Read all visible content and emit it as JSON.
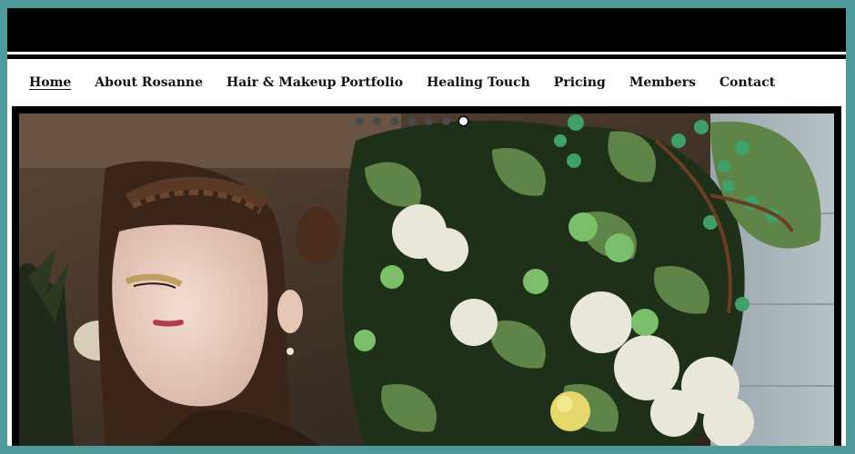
{
  "nav": {
    "items": [
      {
        "label": "Home",
        "active": true
      },
      {
        "label": "About Rosanne"
      },
      {
        "label": "Hair & Makeup Portfolio"
      },
      {
        "label": "Healing Touch"
      },
      {
        "label": "Pricing"
      },
      {
        "label": "Members"
      },
      {
        "label": "Contact"
      }
    ]
  },
  "slider": {
    "slide_count": 7,
    "active_index": 6,
    "colors": {
      "frame": "#4e9a9b",
      "header": "#000000"
    }
  }
}
